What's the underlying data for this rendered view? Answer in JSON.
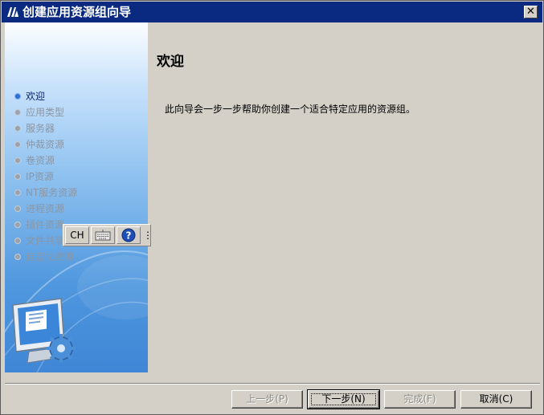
{
  "window": {
    "title": "创建应用资源组向导",
    "close_symbol": "✕"
  },
  "sidebar": {
    "steps": [
      {
        "label": "欢迎",
        "active": true
      },
      {
        "label": "应用类型",
        "active": false
      },
      {
        "label": "服务器",
        "active": false
      },
      {
        "label": "仲裁资源",
        "active": false
      },
      {
        "label": "卷资源",
        "active": false
      },
      {
        "label": "IP资源",
        "active": false
      },
      {
        "label": "NT服务资源",
        "active": false
      },
      {
        "label": "进程资源",
        "active": false
      },
      {
        "label": "插件资源",
        "active": false
      },
      {
        "label": "文件共享",
        "active": false
      },
      {
        "label": "自定义资源",
        "active": false
      }
    ]
  },
  "ime_toolbar": {
    "lang": "CH",
    "keyboard_icon": "keyboard-icon",
    "help_icon": "help-icon",
    "arrow": "⋮"
  },
  "content": {
    "title": "欢迎",
    "description": "此向导会一步一步帮助你创建一个适合特定应用的资源组。"
  },
  "buttons": {
    "back": "上一步(P)",
    "next": "下一步(N)",
    "finish": "完成(F)",
    "cancel": "取消(C)"
  },
  "colors": {
    "titlebar": "#0a2a82",
    "active_step": "#0a246a",
    "face": "#d4d0c8"
  }
}
